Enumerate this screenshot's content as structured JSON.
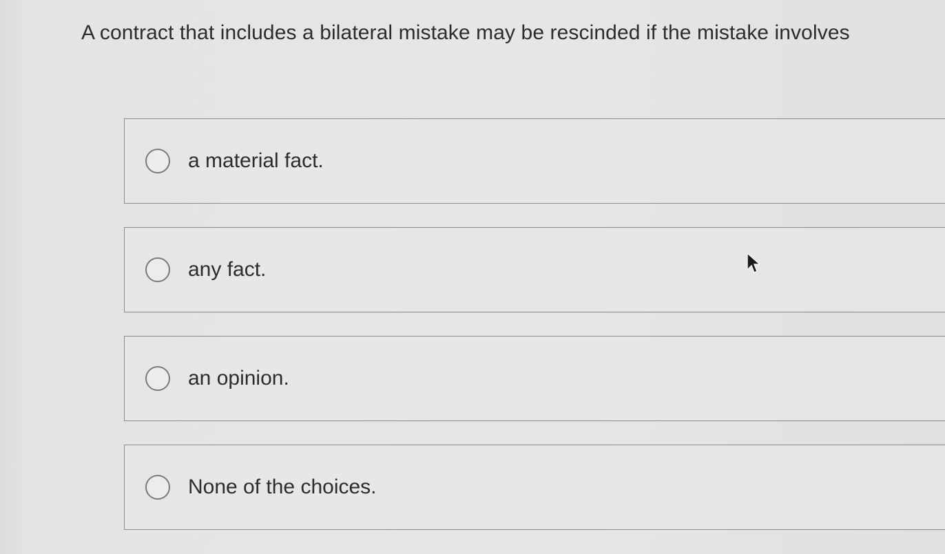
{
  "question": {
    "text": "A contract that includes a bilateral mistake may be rescinded if the mistake involves"
  },
  "options": [
    {
      "label": "a material fact.",
      "selected": false
    },
    {
      "label": "any fact.",
      "selected": false
    },
    {
      "label": "an opinion.",
      "selected": false
    },
    {
      "label": "None of the choices.",
      "selected": false
    }
  ],
  "icons": {
    "radio": "radio-button-icon",
    "cursor": "mouse-pointer-icon"
  }
}
